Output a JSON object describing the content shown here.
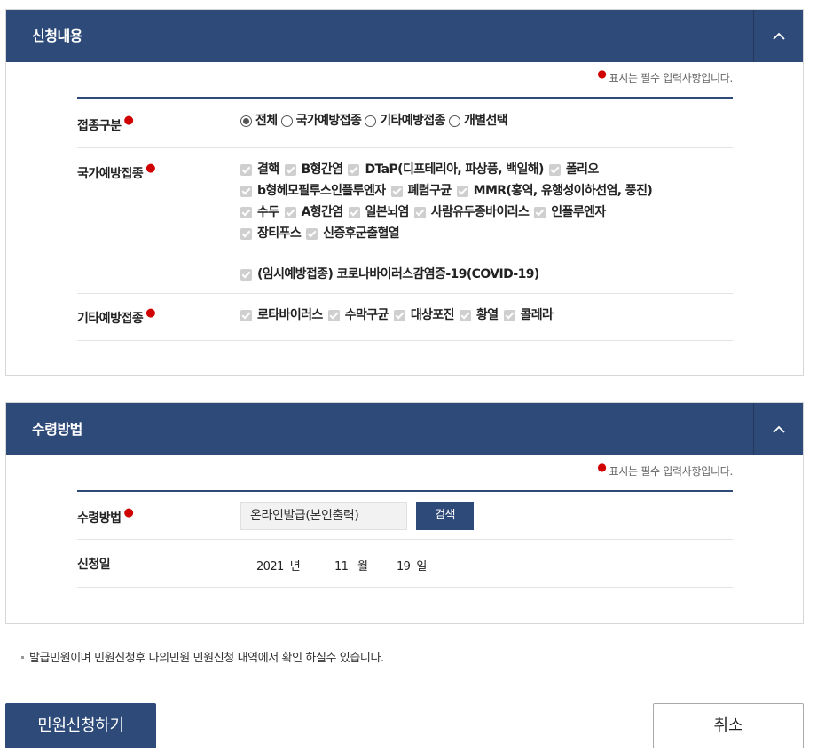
{
  "required_note": "표시는 필수 입력사항입니다.",
  "application": {
    "title": "신청내용",
    "collapse_icon": "chevron-up-icon",
    "type": {
      "label": "접종구분",
      "options": [
        "전체",
        "국가예방접종",
        "기타예방접종",
        "개별선택"
      ],
      "selected": "전체"
    },
    "national": {
      "label": "국가예방접종",
      "lines": [
        [
          "결핵",
          "B형간염",
          "DTaP(디프테리아, 파상풍, 백일해)",
          "폴리오"
        ],
        [
          "b형헤모필루스인플루엔자",
          "폐렴구균",
          "MMR(홍역, 유행성이하선염, 풍진)"
        ],
        [
          "수두",
          "A형간염",
          "일본뇌염",
          "사람유두종바이러스",
          "인플루엔자"
        ],
        [
          "장티푸스",
          "신증후군출혈열"
        ]
      ],
      "extra": "(임시예방접종) 코로나바이러스감염증-19(COVID-19)"
    },
    "other": {
      "label": "기타예방접종",
      "items": [
        "로타바이러스",
        "수막구균",
        "대상포진",
        "황열",
        "콜레라"
      ]
    }
  },
  "receipt": {
    "title": "수령방법",
    "collapse_icon": "chevron-up-icon",
    "method": {
      "label": "수령방법",
      "value": "온라인발급(본인출력)",
      "search_label": "검색"
    },
    "date": {
      "label": "신청일",
      "year": "2021",
      "year_unit": "년",
      "month": "11",
      "month_unit": "월",
      "day": "19",
      "day_unit": "일"
    }
  },
  "notice": "발급민원이며 민원신청후 나의민원 민원신청 내역에서 확인 하실수 있습니다.",
  "buttons": {
    "submit": "민원신청하기",
    "cancel": "취소"
  },
  "colors": {
    "header": "#2e4a79",
    "required": "#d00000",
    "checkbox": "#cfcfcf"
  }
}
